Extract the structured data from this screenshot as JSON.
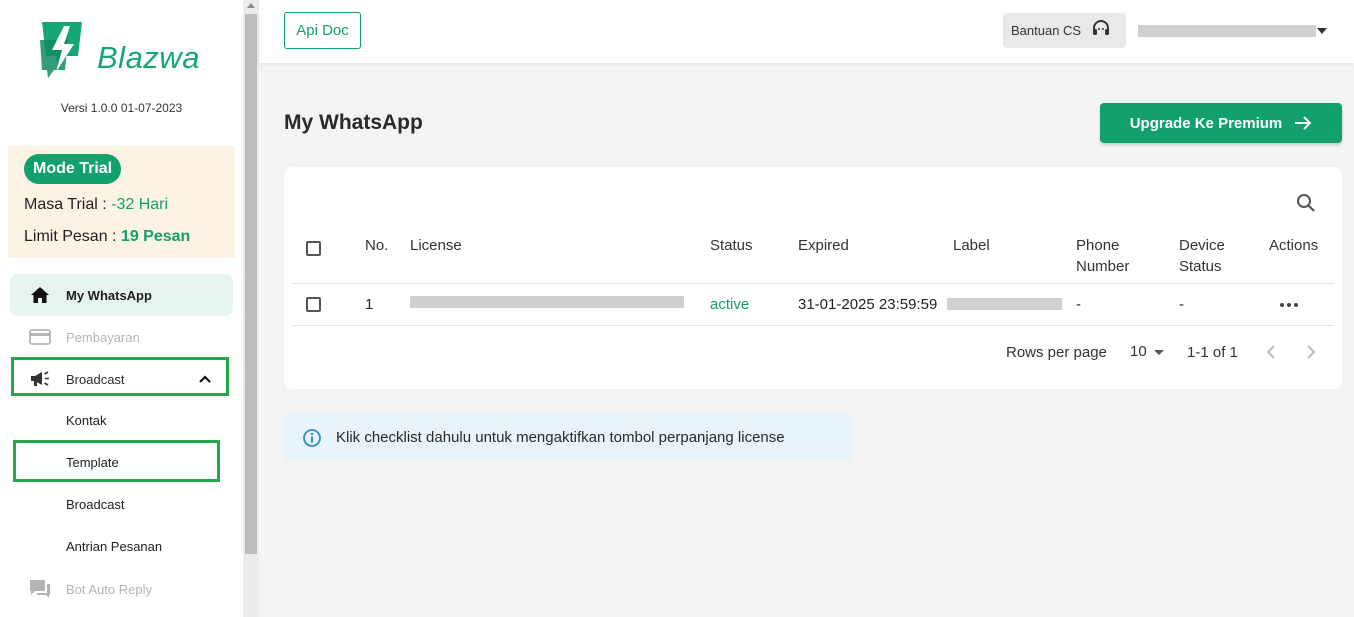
{
  "sidebar": {
    "brand": "Blazwa",
    "version": "Versi 1.0.0 01-07-2023",
    "trial": {
      "badge": "Mode Trial",
      "masa_label": "Masa Trial : ",
      "masa_value": "-32 Hari",
      "limit_label": "Limit Pesan : ",
      "limit_value": "19 Pesan"
    },
    "items": [
      {
        "label": "My WhatsApp",
        "icon": "home-icon",
        "active": true
      },
      {
        "label": "Pembayaran",
        "icon": "credit-card-icon",
        "disabled": true
      },
      {
        "label": "Broadcast",
        "icon": "megaphone-icon",
        "expanded": true
      },
      {
        "label": "Bot Auto Reply",
        "icon": "chat-bubble-icon",
        "disabled": true
      }
    ],
    "broadcast_sub": [
      "Kontak",
      "Template",
      "Broadcast",
      "Antrian Pesanan"
    ]
  },
  "topbar": {
    "api_doc": "Api Doc",
    "bantuan": "Bantuan CS"
  },
  "main": {
    "title": "My WhatsApp",
    "upgrade": "Upgrade Ke Premium",
    "table": {
      "headers": [
        "No.",
        "License",
        "Status",
        "Expired",
        "Label",
        "Phone Number",
        "Device Status",
        "Actions"
      ],
      "phone_header": [
        "Phone",
        "Number"
      ],
      "device_header": [
        "Device",
        "Status"
      ],
      "rows": [
        {
          "no": "1",
          "status": "active",
          "expired": "31-01-2025 23:59:59",
          "phone": "-",
          "device": "-"
        }
      ]
    },
    "pagination": {
      "rows_label": "Rows per page",
      "rows_value": "10",
      "range": "1-1 of 1"
    },
    "info": "Klik checklist dahulu untuk mengaktifkan tombol perpanjang license"
  },
  "colors": {
    "accent": "#12a06d",
    "highlight": "#21a947",
    "trial_bg": "#fdf3e4",
    "info_bg": "#e9f3fa"
  }
}
